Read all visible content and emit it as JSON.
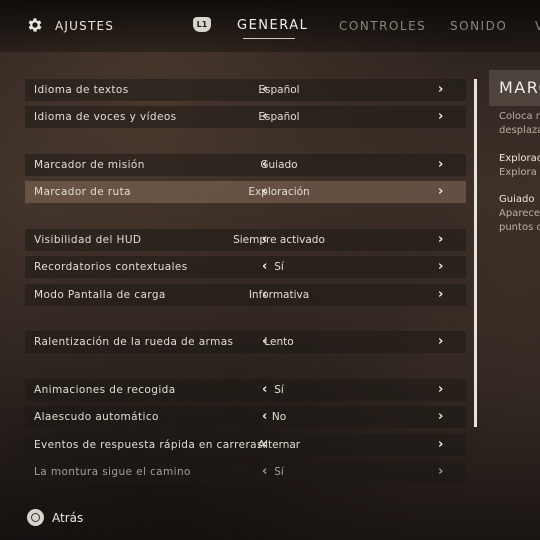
{
  "header": {
    "title": "AJUSTES",
    "l1_label": "L1",
    "tabs": [
      {
        "label": "GENERAL",
        "active": true
      },
      {
        "label": "CONTROLES",
        "active": false
      },
      {
        "label": "SONIDO",
        "active": false
      },
      {
        "label": "V",
        "active": false
      }
    ]
  },
  "settings": [
    {
      "label": "Idioma de textos",
      "value": "Español"
    },
    {
      "label": "Idioma de voces y vídeos",
      "value": "Español"
    },
    {
      "label": "Marcador de misión",
      "value": "Guiado"
    },
    {
      "label": "Marcador de ruta",
      "value": "Exploración",
      "selected": true
    },
    {
      "label": "Visibilidad del HUD",
      "value": "Siempre activado"
    },
    {
      "label": "Recordatorios contextuales",
      "value": "Sí"
    },
    {
      "label": "Modo Pantalla de carga",
      "value": "Informativa"
    },
    {
      "label": "Ralentización de la rueda de armas",
      "value": "Lento"
    },
    {
      "label": "Animaciones de recogida",
      "value": "Sí"
    },
    {
      "label": "Alaescudo automático",
      "value": "No"
    },
    {
      "label": "Eventos de respuesta rápida en carreras",
      "value": "Alternar"
    },
    {
      "label": "La montura sigue el camino",
      "value": "Sí"
    }
  ],
  "arrows": {
    "left": "‹",
    "right": "›"
  },
  "panel": {
    "title": "MARC",
    "lines": [
      "Coloca m",
      "desplaza",
      "Explorac",
      "Explora",
      "Guiado",
      "Aparece",
      "puntos d"
    ]
  },
  "footer": {
    "back_label": "Atrás"
  }
}
